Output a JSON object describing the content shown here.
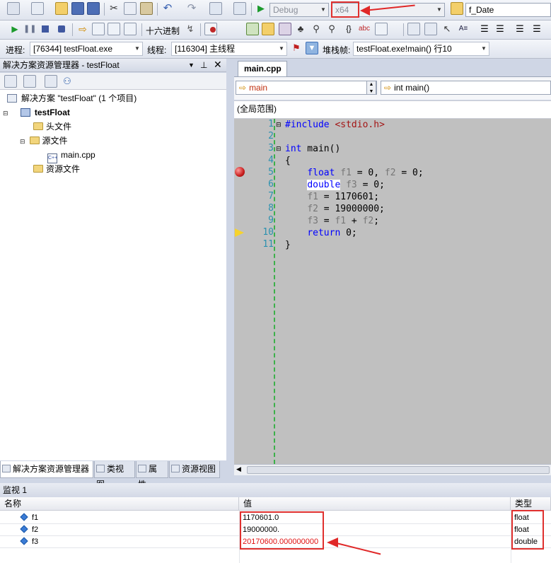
{
  "toolbar1": {
    "config": "Debug",
    "platform": "x64",
    "find_value": "f_Date"
  },
  "toolbar2": {
    "hex_label": "十六进制"
  },
  "debugbar": {
    "process_label": "进程:",
    "process_value": "[76344] testFloat.exe",
    "thread_label": "线程:",
    "thread_value": "[116304] 主线程",
    "stack_label": "堆栈帧:",
    "stack_value": "testFloat.exe!main()  行10"
  },
  "solution_explorer": {
    "title": "解决方案资源管理器 - testFloat",
    "solution": "解决方案 \"testFloat\" (1 个项目)",
    "project": "testFloat",
    "headers": "头文件",
    "sources": "源文件",
    "file": "main.cpp",
    "resources": "资源文件"
  },
  "bottom_tabs": [
    "解决方案资源管理器",
    "类视图",
    "属性",
    "资源视图"
  ],
  "editor": {
    "tab": "main.cpp",
    "scope_combo": "main",
    "func_combo": "int main()",
    "global_scope": "(全局范围)",
    "line_numbers": [
      "1",
      "2",
      "3",
      "4",
      "5",
      "6",
      "7",
      "8",
      "9",
      "10",
      "11"
    ]
  },
  "watch": {
    "title": "监视 1",
    "col_name": "名称",
    "col_value": "值",
    "col_type": "类型",
    "rows": [
      {
        "name": "f1",
        "value": "1170601.0",
        "type": "float"
      },
      {
        "name": "f2",
        "value": "19000000.",
        "type": "float"
      },
      {
        "name": "f3",
        "value": "20170600.000000000",
        "type": "double"
      }
    ]
  }
}
